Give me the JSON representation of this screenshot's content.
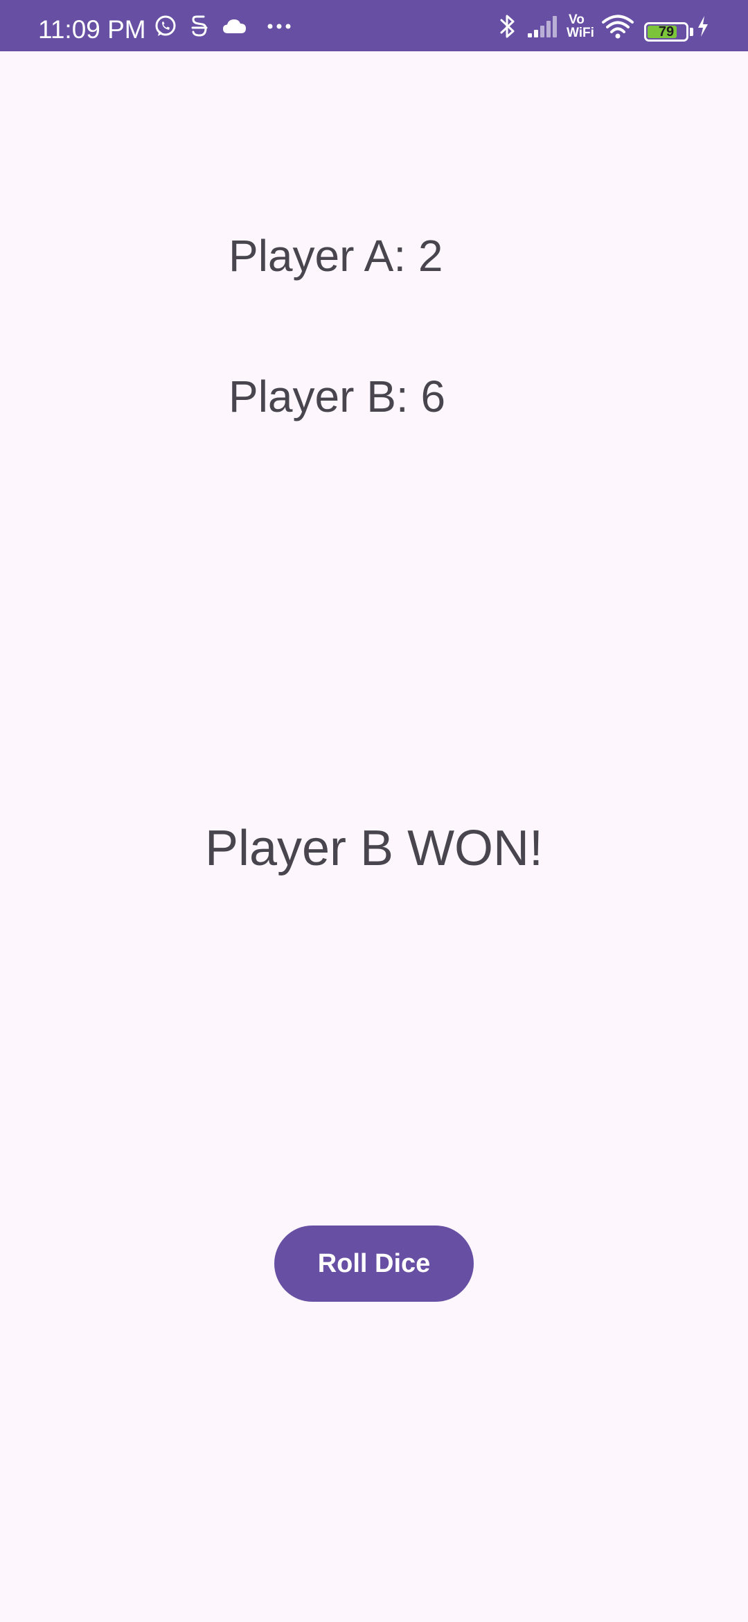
{
  "status_bar": {
    "time": "11:09 PM",
    "left_icons": [
      "whatsapp-icon",
      "cast-icon",
      "cloud-icon",
      "more-dots-icon"
    ],
    "right_icons": [
      "bluetooth-icon",
      "signal-icon",
      "vowifi-icon",
      "wifi-icon",
      "battery-icon",
      "charging-icon"
    ],
    "vowifi_top": "Vo",
    "vowifi_bottom": "WiFi",
    "battery_level": "79",
    "battery_percent": 79,
    "background_color": "#6750a4",
    "battery_fill_color": "#7cc43a"
  },
  "game": {
    "player_a_label": "Player A: 2",
    "player_b_label": "Player B: 6",
    "result_text": "Player B WON!",
    "roll_button_label": "Roll Dice"
  },
  "colors": {
    "accent": "#6750a4",
    "background": "#fdf7fd",
    "text": "#49454f"
  }
}
